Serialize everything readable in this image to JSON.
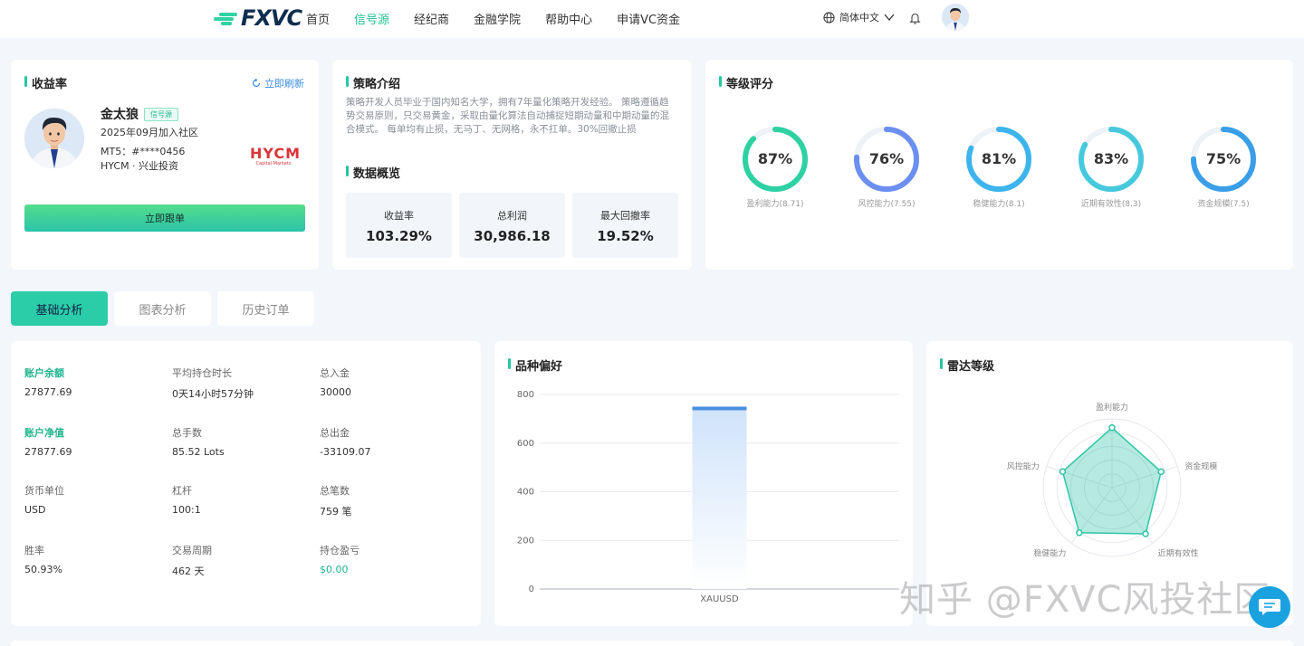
{
  "nav": {
    "logo": "FXVC",
    "links": [
      "首页",
      "信号源",
      "经纪商",
      "金融学院",
      "帮助中心",
      "申请VC资金"
    ],
    "active_index": 1,
    "language": "简体中文"
  },
  "profile": {
    "section_title": "收益率",
    "refresh_label": "立即刷新",
    "name": "金太狼",
    "badge": "信号源",
    "joined": "2025年09月加入社区",
    "mt5": "MT5：#****0456",
    "broker_line": "HYCM · 兴业投资",
    "broker_logo": "HYCM",
    "broker_logo_sub": "Capital Markets",
    "follow_button": "立即跟单"
  },
  "strategy": {
    "title": "策略介绍",
    "intro": "策略开发人员毕业于国内知名大学，拥有7年量化策略开发经验。 策略遵循趋势交易原则，只交易黄金，采取由量化算法自动捕捉短期动量和中期动量的混合模式。 每单均有止损，无马丁、无网格，永不扛单。30%回撤止损",
    "overview_title": "数据概览",
    "stats": [
      {
        "label": "收益率",
        "value": "103.29%"
      },
      {
        "label": "总利润",
        "value": "30,986.18"
      },
      {
        "label": "最大回撤率",
        "value": "19.52%"
      }
    ]
  },
  "rating": {
    "title": "等级评分",
    "gauges": [
      {
        "pct": 87,
        "label": "盈利能力(8.71)",
        "color": "#2ed1a4"
      },
      {
        "pct": 76,
        "label": "风控能力(7.55)",
        "color": "#6b8ff0"
      },
      {
        "pct": 81,
        "label": "稳健能力(8.1)",
        "color": "#3db4ee"
      },
      {
        "pct": 83,
        "label": "近期有效性(8.3)",
        "color": "#47c9dd"
      },
      {
        "pct": 75,
        "label": "资金规模(7.5)",
        "color": "#3a9ee8"
      }
    ]
  },
  "tabs": [
    "基础分析",
    "图表分析",
    "历史订单"
  ],
  "account": {
    "items": [
      {
        "label": "账户余额",
        "value": "27877.69",
        "highlight": true
      },
      {
        "label": "平均持仓时长",
        "value": "0天14小时57分钟"
      },
      {
        "label": "总入金",
        "value": "30000"
      },
      {
        "label": "账户净值",
        "value": "27877.69",
        "highlight": true
      },
      {
        "label": "总手数",
        "value": "85.52 Lots"
      },
      {
        "label": "总出金",
        "value": "-33109.07"
      },
      {
        "label": "货币单位",
        "value": "USD"
      },
      {
        "label": "杠杆",
        "value": "100:1"
      },
      {
        "label": "总笔数",
        "value": "759 笔"
      },
      {
        "label": "胜率",
        "value": "50.93%"
      },
      {
        "label": "交易周期",
        "value": "462 天"
      },
      {
        "label": "持仓盈亏",
        "value": "$0.00",
        "green": true
      }
    ]
  },
  "variety": {
    "title": "品种偏好",
    "chart_data": {
      "type": "bar",
      "categories": [
        "XAUUSD"
      ],
      "values": [
        750
      ],
      "ylim": [
        0,
        800
      ],
      "yticks": [
        "0",
        "200",
        "400",
        "600",
        "800"
      ],
      "grid": true,
      "color": "#4a90e2"
    }
  },
  "radar": {
    "title": "雷达等级",
    "axes": [
      "盈利能力",
      "资金规模",
      "近期有效性",
      "稳健能力",
      "风控能力"
    ],
    "values": [
      8.71,
      7.5,
      8.3,
      8.1,
      7.55
    ],
    "max": 10,
    "color": "#2ec4a6"
  },
  "watermark": "知乎 @FXVC风投社区"
}
